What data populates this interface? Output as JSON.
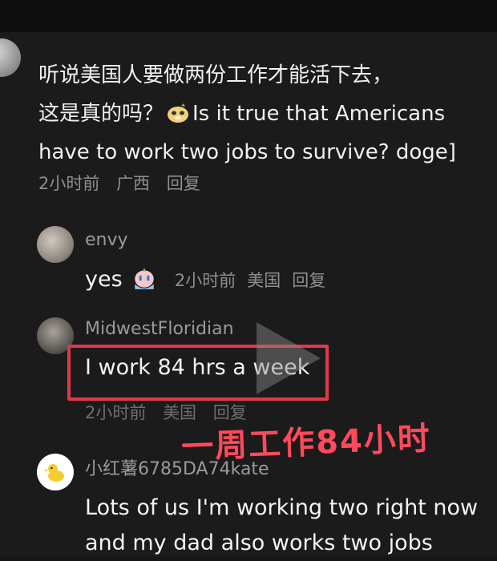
{
  "main_comment": {
    "line1": "听说美国人要做两份工作才能活下去，",
    "line2_a": "这是真的吗？",
    "line2_b": "Is it true that Americans",
    "line3": "have to work two jobs to survive? doge]",
    "time": "2小时前",
    "location": "广西",
    "reply_label": "回复"
  },
  "replies": [
    {
      "username": "envy",
      "text": "yes",
      "time": "2小时前",
      "location": "美国",
      "reply_label": "回复"
    },
    {
      "username": "MidwestFloridian",
      "text": "I work 84 hrs a week",
      "time": "2小时前",
      "location": "美国",
      "reply_label": "回复"
    },
    {
      "username": "小红薯6785DA74kate",
      "text_line1": "Lots of us I'm working two right now",
      "text_line2": "and my dad also works two jobs"
    }
  ],
  "annotation": "一周工作84小时",
  "colors": {
    "background": "#1b1b1b",
    "highlight_border": "#e0384a",
    "annotation": "#ff4a5c"
  }
}
